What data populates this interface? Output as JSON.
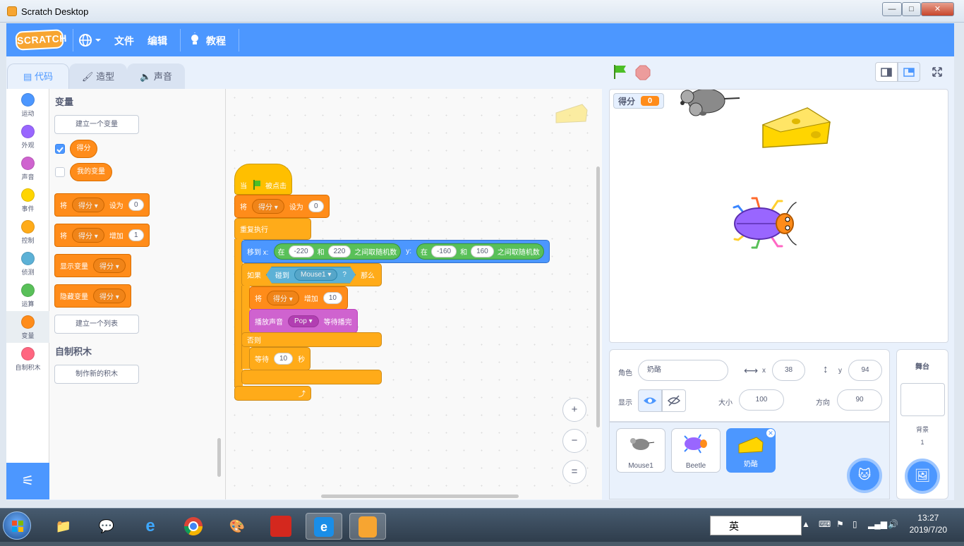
{
  "window": {
    "title": "Scratch Desktop",
    "minimize": "—",
    "maximize": "□",
    "close": "✕"
  },
  "menubar": {
    "logo": "SCRATCH",
    "globe_icon": "globe-icon",
    "file": "文件",
    "edit": "编辑",
    "tutorials": "教程"
  },
  "tabs": {
    "code": "代码",
    "costumes": "造型",
    "sounds": "声音"
  },
  "categories": [
    {
      "label": "运动",
      "color": "#4c97ff"
    },
    {
      "label": "外观",
      "color": "#9966ff"
    },
    {
      "label": "声音",
      "color": "#cf63cf"
    },
    {
      "label": "事件",
      "color": "#ffd500"
    },
    {
      "label": "控制",
      "color": "#ffab19"
    },
    {
      "label": "侦测",
      "color": "#5cb1d6"
    },
    {
      "label": "运算",
      "color": "#59c059"
    },
    {
      "label": "变量",
      "color": "#ff8c1a"
    },
    {
      "label": "自制积木",
      "color": "#ff6680"
    }
  ],
  "palette": {
    "heading_variables": "变量",
    "make_variable": "建立一个变量",
    "var_score": "得分",
    "var_my": "我的变量",
    "set_block": {
      "kw": "将",
      "var": "得分",
      "op": "设为",
      "value": "0"
    },
    "change_block": {
      "kw": "将",
      "var": "得分",
      "op": "增加",
      "value": "1"
    },
    "show_block": {
      "kw": "显示变量",
      "var": "得分"
    },
    "hide_block": {
      "kw": "隐藏变量",
      "var": "得分"
    },
    "make_list": "建立一个列表",
    "heading_myblocks": "自制积木",
    "make_block": "制作新的积木"
  },
  "script": {
    "hat": {
      "pre": "当",
      "post": "被点击"
    },
    "set": {
      "kw": "将",
      "var": "得分",
      "op": "设为",
      "value": "0"
    },
    "forever": "重复执行",
    "goto": {
      "kw": "移到 x:",
      "r1": "在",
      "a": "-220",
      "and": "和",
      "b": "220",
      "r2": "之间取随机数",
      "ykw": "y:",
      "c": "-160",
      "d": "160"
    },
    "if": {
      "kw": "如果",
      "touch": "碰到",
      "target": "Mouse1",
      "q": "?",
      "then": "那么"
    },
    "change": {
      "kw": "将",
      "var": "得分",
      "op": "增加",
      "value": "10"
    },
    "play": {
      "kw": "播放声音",
      "sound": "Pop",
      "until": "等待播完"
    },
    "else": "否则",
    "wait": {
      "kw": "等待",
      "value": "10",
      "unit": "秒"
    }
  },
  "zoom": {
    "in": "+",
    "out": "−",
    "reset": "="
  },
  "stage": {
    "monitor_label": "得分",
    "monitor_value": "0"
  },
  "sprite_info": {
    "name_label": "角色",
    "name": "奶酪",
    "x_label": "x",
    "x": "38",
    "y_label": "y",
    "y": "94",
    "show_label": "显示",
    "size_label": "大小",
    "size": "100",
    "direction_label": "方向",
    "direction": "90"
  },
  "sprites": [
    {
      "name": "Mouse1",
      "selected": false
    },
    {
      "name": "Beetle",
      "selected": false
    },
    {
      "name": "奶酪",
      "selected": true
    }
  ],
  "stage_panel": {
    "title": "舞台",
    "backdrop_label": "背景",
    "backdrop_count": "1"
  },
  "taskbar": {
    "time": "13:27",
    "date": "2019/7/20",
    "ime": "英"
  }
}
